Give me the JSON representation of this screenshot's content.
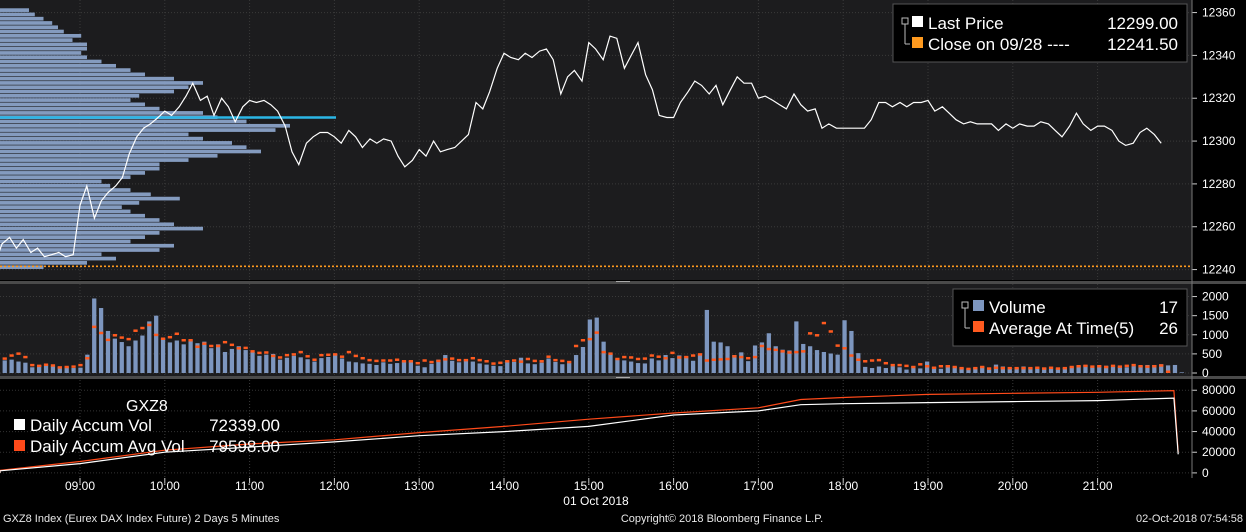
{
  "colors": {
    "background": "#000000",
    "panel": "#1c1c1e",
    "grid": "#3a3a3a",
    "price_line": "#ffffff",
    "close_line": "#ff9a1f",
    "vap": "#8aa2c8",
    "vap_highlight": "#2bb6e6",
    "volume_bar": "#7d96bf",
    "avg_marker": "#ff5a1f",
    "accum_vol": "#ffffff",
    "accum_avg": "#ff4a1a",
    "text": "#ffffff"
  },
  "top_panel": {
    "legend": {
      "last_price_label": "Last Price",
      "last_price_value": "12299.00",
      "close_label": "Close on 09/28 ----",
      "close_value": "12241.50"
    }
  },
  "mid_panel": {
    "legend": {
      "volume_label": "Volume",
      "volume_value": "17",
      "avg_label": "Average At Time(5)",
      "avg_value": "26"
    }
  },
  "bottom_panel": {
    "legend": {
      "ticker": "GXZ8",
      "accum_label": "Daily Accum Vol",
      "accum_value": "72339.00",
      "accum_avg_label": "Daily Accum Avg Vol",
      "accum_avg_value": "79598.00"
    }
  },
  "x_axis": {
    "ticks": [
      "09:00",
      "10:00",
      "11:00",
      "12:00",
      "13:00",
      "14:00",
      "15:00",
      "16:00",
      "17:00",
      "18:00",
      "19:00",
      "20:00",
      "21:00"
    ],
    "date_label": "01 Oct 2018"
  },
  "footer": {
    "left": "GXZ8 Index (Eurex DAX Index Future) 2 Days 5 Minutes",
    "center": "Copyright© 2018 Bloomberg Finance L.P.",
    "right": "02-Oct-2018 07:54:58"
  },
  "chart_data": [
    {
      "type": "line",
      "name": "price",
      "x_hours": [
        8.0,
        8.08,
        8.17,
        8.25,
        8.33,
        8.42,
        8.5,
        8.58,
        8.67,
        8.75,
        8.83,
        8.92,
        9.0,
        9.08,
        9.17,
        9.25,
        9.33,
        9.42,
        9.5,
        9.58,
        9.67,
        9.75,
        9.83,
        9.92,
        10.0,
        10.08,
        10.17,
        10.25,
        10.33,
        10.42,
        10.5,
        10.58,
        10.67,
        10.75,
        10.83,
        10.92,
        11.0,
        11.08,
        11.17,
        11.25,
        11.33,
        11.42,
        11.5,
        11.58,
        11.67,
        11.75,
        11.83,
        11.92,
        12.0,
        12.08,
        12.17,
        12.25,
        12.33,
        12.42,
        12.5,
        12.58,
        12.67,
        12.75,
        12.83,
        12.92,
        13.0,
        13.08,
        13.17,
        13.25,
        13.33,
        13.42,
        13.5,
        13.58,
        13.67,
        13.75,
        13.83,
        13.92,
        14.0,
        14.08,
        14.17,
        14.25,
        14.33,
        14.42,
        14.5,
        14.58,
        14.67,
        14.75,
        14.83,
        14.92,
        15.0,
        15.08,
        15.17,
        15.25,
        15.33,
        15.42,
        15.5,
        15.58,
        15.67,
        15.75,
        15.83,
        15.92,
        16.0,
        16.08,
        16.17,
        16.25,
        16.33,
        16.42,
        16.5,
        16.58,
        16.67,
        16.75,
        16.83,
        16.92,
        17.0,
        17.08,
        17.17,
        17.25,
        17.33,
        17.42,
        17.5,
        17.58,
        17.67,
        17.75,
        17.83,
        17.92,
        18.0,
        18.08,
        18.17,
        18.25,
        18.33,
        18.42,
        18.5,
        18.58,
        18.67,
        18.75,
        18.83,
        18.92,
        19.0,
        19.08,
        19.17,
        19.25,
        19.33,
        19.42,
        19.5,
        19.58,
        19.67,
        19.75,
        19.83,
        19.92,
        20.0,
        20.08,
        20.17,
        20.25,
        20.33,
        20.42,
        20.5,
        20.58,
        20.67,
        20.75,
        20.83,
        20.92,
        21.0,
        21.08,
        21.17,
        21.25,
        21.33,
        21.42,
        21.5,
        21.58,
        21.67,
        21.75,
        21.83,
        21.92
      ],
      "values": [
        12243,
        12252,
        12255,
        12250,
        12254,
        12248,
        12250,
        12246,
        12247,
        12248,
        12246,
        12247,
        12270,
        12279,
        12264,
        12272,
        12276,
        12279,
        12283,
        12294,
        12302,
        12306,
        12308,
        12311,
        12314,
        12312,
        12316,
        12321,
        12327,
        12319,
        12321,
        12312,
        12320,
        12316,
        12309,
        12316,
        12319,
        12318,
        12319,
        12317,
        12314,
        12307,
        12295,
        12289,
        12299,
        12302,
        12304,
        12304,
        12302,
        12299,
        12305,
        12302,
        12297,
        12301,
        12299,
        12301,
        12300,
        12293,
        12288,
        12291,
        12296,
        12293,
        12300,
        12295,
        12296,
        12297,
        12300,
        12303,
        12318,
        12315,
        12323,
        12334,
        12341,
        12339,
        12338,
        12341,
        12339,
        12342,
        12343,
        12338,
        12322,
        12330,
        12333,
        12328,
        12346,
        12343,
        12338,
        12349,
        12348,
        12334,
        12340,
        12346,
        12331,
        12324,
        12312,
        12311,
        12311,
        12318,
        12323,
        12328,
        12326,
        12322,
        12326,
        12317,
        12324,
        12330,
        12327,
        12327,
        12320,
        12321,
        12319,
        12317,
        12315,
        12322,
        12317,
        12314,
        12315,
        12306,
        12308,
        12306,
        12306,
        12306,
        12306,
        12306,
        12310,
        12318,
        12318,
        12316,
        12318,
        12316,
        12318,
        12318,
        12319,
        12314,
        12316,
        12313,
        12310,
        12308,
        12309,
        12308,
        12308,
        12308,
        12305,
        12308,
        12306,
        12308,
        12307,
        12307,
        12309,
        12308,
        12305,
        12302,
        12307,
        12313,
        12308,
        12305,
        12307,
        12307,
        12305,
        12300,
        12298,
        12299,
        12304,
        12306,
        12303,
        12299
      ]
    },
    {
      "type": "line",
      "name": "close_reference",
      "value": 12241.5
    },
    {
      "type": "bar",
      "name": "volume_at_price",
      "price_levels_start": 12240,
      "price_step": 2,
      "relative_volume": [
        0.15,
        0.3,
        0.4,
        0.35,
        0.55,
        0.6,
        0.45,
        0.5,
        0.55,
        0.7,
        0.6,
        0.55,
        0.5,
        0.45,
        0.42,
        0.48,
        0.62,
        0.52,
        0.45,
        0.38,
        0.35,
        0.45,
        0.5,
        0.55,
        0.55,
        0.65,
        0.75,
        0.9,
        0.85,
        0.8,
        0.7,
        0.65,
        0.95,
        1.0,
        0.85,
        0.75,
        0.7,
        0.55,
        0.5,
        0.45,
        0.48,
        0.6,
        0.65,
        0.7,
        0.6,
        0.5,
        0.45,
        0.4,
        0.35,
        0.3,
        0.28,
        0.3,
        0.3,
        0.25,
        0.28,
        0.22,
        0.2,
        0.18,
        0.15,
        0.12,
        0.1
      ]
    },
    {
      "type": "bar",
      "name": "volume",
      "ylim": [
        0,
        2250
      ],
      "values": [
        330,
        350,
        300,
        270,
        150,
        210,
        200,
        180,
        160,
        150,
        130,
        140,
        480,
        1950,
        1700,
        1100,
        900,
        810,
        700,
        850,
        980,
        1350,
        1500,
        900,
        800,
        850,
        750,
        850,
        780,
        820,
        650,
        750,
        550,
        630,
        700,
        600,
        550,
        450,
        480,
        500,
        350,
        400,
        450,
        410,
        360,
        300,
        390,
        420,
        500,
        380,
        300,
        280,
        250,
        240,
        210,
        280,
        240,
        260,
        300,
        320,
        190,
        150,
        240,
        350,
        470,
        320,
        280,
        360,
        300,
        250,
        220,
        190,
        180,
        300,
        290,
        400,
        250,
        230,
        270,
        380,
        290,
        230,
        260,
        470,
        680,
        1400,
        1450,
        820,
        500,
        350,
        330,
        300,
        260,
        250,
        380,
        330,
        470,
        390,
        460,
        400,
        320,
        480,
        1650,
        820,
        800,
        700,
        470,
        540,
        310,
        720,
        800,
        1040,
        700,
        610,
        590,
        1350,
        760,
        700,
        600,
        550,
        510,
        480,
        1380,
        1100,
        520,
        160,
        130,
        170,
        130,
        180,
        150,
        90,
        180,
        120,
        300,
        160,
        110,
        200,
        160,
        130,
        110,
        140,
        170,
        90,
        220,
        170,
        110,
        130,
        170,
        140,
        140,
        140,
        110,
        120,
        130,
        150,
        180,
        210,
        150,
        170,
        190,
        170,
        160,
        150,
        180,
        190,
        210,
        210,
        230,
        200,
        210,
        17
      ],
      "average": [
        370,
        450,
        500,
        410,
        200,
        180,
        210,
        190,
        140,
        150,
        160,
        200,
        380,
        1200,
        1040,
        860,
        980,
        920,
        880,
        1100,
        1170,
        1250,
        990,
        890,
        930,
        1020,
        850,
        850,
        680,
        760,
        700,
        700,
        800,
        730,
        640,
        650,
        560,
        520,
        530,
        440,
        400,
        460,
        480,
        540,
        430,
        340,
        460,
        470,
        480,
        420,
        540,
        440,
        380,
        330,
        310,
        320,
        320,
        340,
        300,
        300,
        250,
        320,
        280,
        310,
        350,
        370,
        330,
        330,
        380,
        330,
        300,
        240,
        260,
        300,
        320,
        290,
        360,
        310,
        300,
        420,
        330,
        310,
        280,
        700,
        850,
        880,
        1050,
        540,
        500,
        360,
        410,
        400,
        360,
        370,
        450,
        420,
        380,
        520,
        400,
        410,
        450,
        480,
        320,
        340,
        350,
        360,
        430,
        410,
        380,
        410,
        700,
        620,
        600,
        560,
        530,
        540,
        560,
        1030,
        980,
        1300,
        1080,
        710,
        640,
        450,
        340,
        300,
        320,
        330,
        250,
        200,
        200,
        180,
        150,
        220,
        170,
        130,
        170,
        170,
        150,
        120,
        100,
        120,
        150,
        110,
        130,
        120,
        120,
        120,
        120,
        120,
        130,
        110,
        130,
        110,
        120,
        150,
        170,
        180,
        160,
        170,
        150,
        180,
        160,
        180,
        200,
        170,
        160,
        170,
        190,
        26
      ]
    },
    {
      "type": "area",
      "name": "daily_accum",
      "ylim": [
        -3000,
        87000
      ],
      "x_hours": [
        7.0,
        8.0,
        9.0,
        10.0,
        11.0,
        12.0,
        13.0,
        14.0,
        15.0,
        16.0,
        17.0,
        17.5,
        18.0,
        19.0,
        20.0,
        21.0,
        21.9,
        21.95
      ],
      "accum_vol": [
        0,
        2000,
        9000,
        20000,
        25000,
        30000,
        36000,
        40000,
        45000,
        56000,
        60000,
        66000,
        67000,
        68000,
        69000,
        70000,
        72339,
        18000
      ],
      "accum_avg_vol": [
        0,
        2500,
        11000,
        22000,
        28000,
        32000,
        39000,
        45000,
        52000,
        58000,
        63000,
        71000,
        73000,
        76000,
        77000,
        78000,
        79598,
        20000
      ]
    }
  ]
}
